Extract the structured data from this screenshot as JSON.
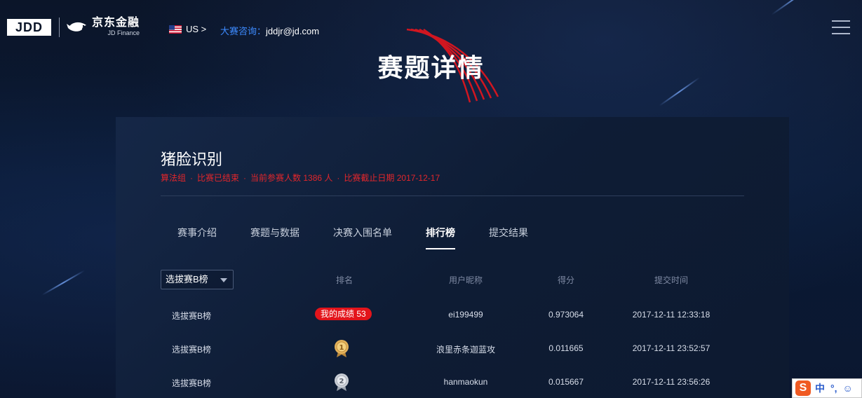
{
  "header": {
    "logo_jdd": "JDD",
    "logo_cn": "京东金融",
    "logo_en": "JD Finance",
    "lang": "US >",
    "contact_label": "大赛咨询：",
    "contact_email": "jddjr@jd.com"
  },
  "hero": {
    "title": "赛题详情"
  },
  "competition": {
    "title": "猪脸识别",
    "meta": [
      "算法组",
      "比赛已结束",
      "当前参赛人数 1386 人",
      "比赛截止日期 2017-12-17"
    ],
    "meta_sep": "·"
  },
  "tabs": [
    {
      "label": "赛事介绍"
    },
    {
      "label": "赛题与数据"
    },
    {
      "label": "决赛入围名单"
    },
    {
      "label": "排行榜"
    },
    {
      "label": "提交结果"
    }
  ],
  "active_tab": 3,
  "leaderboard": {
    "select_value": "选拔赛B榜",
    "columns": [
      "排名",
      "用户昵称",
      "得分",
      "提交时间"
    ],
    "rows": [
      {
        "board": "选拔赛B榜",
        "rank": "我的成绩 53",
        "rank_type": "mine",
        "user": "ei199499",
        "score": "0.973064",
        "time": "2017-12-11 12:33:18"
      },
      {
        "board": "选拔赛B榜",
        "rank": "1",
        "rank_type": "gold",
        "user": "浪里赤条迦蓝攻",
        "score": "0.011665",
        "time": "2017-12-11 23:52:57"
      },
      {
        "board": "选拔赛B榜",
        "rank": "2",
        "rank_type": "silver",
        "user": "hanmaokun",
        "score": "0.015667",
        "time": "2017-12-11 23:56:26"
      }
    ]
  },
  "ime": {
    "logo": "S",
    "items": [
      "中",
      "°,",
      "☺"
    ]
  },
  "colors": {
    "accent_red": "#e3141b",
    "link_blue": "#3d8bff",
    "bg": "#0a1427"
  }
}
